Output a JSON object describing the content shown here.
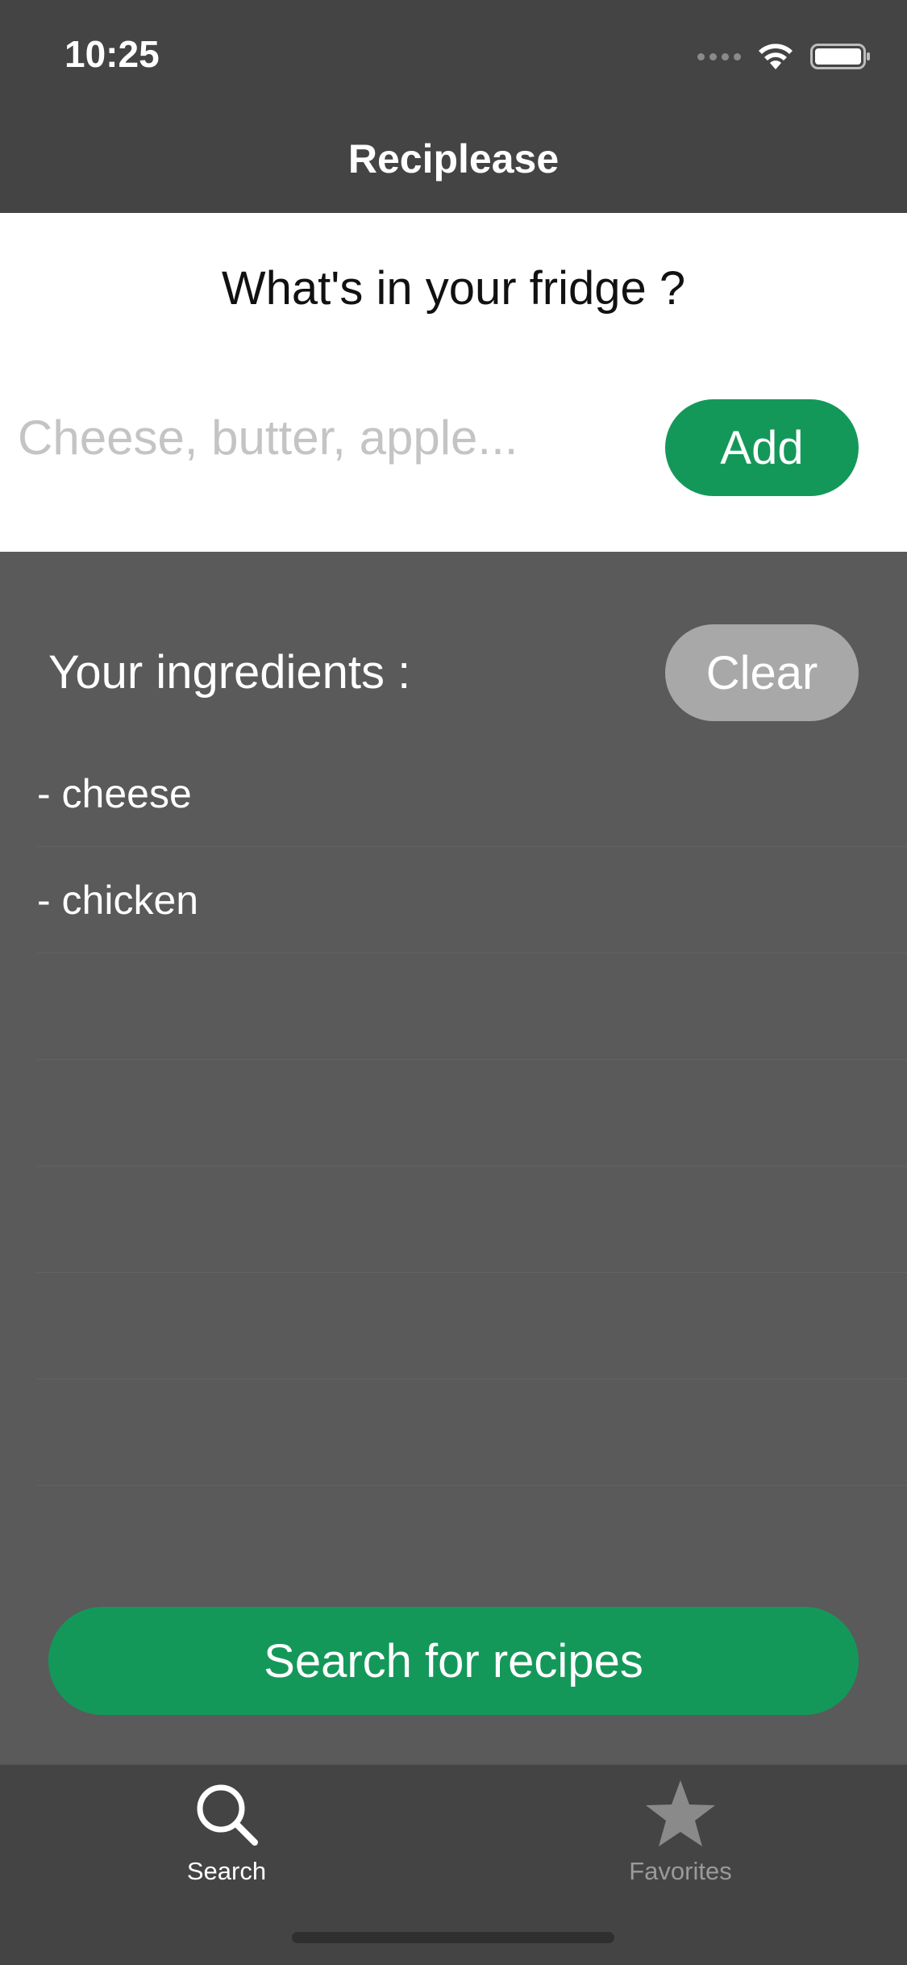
{
  "status_bar": {
    "time": "10:25",
    "icons": [
      "cellular-signal-icon",
      "wifi-icon",
      "battery-icon"
    ]
  },
  "nav": {
    "title": "Reciplease"
  },
  "fridge": {
    "question": "What's in your fridge ?",
    "input_value": "",
    "input_placeholder": "Cheese, butter, apple...",
    "add_label": "Add"
  },
  "ingredients": {
    "header": "Your ingredients :",
    "clear_label": "Clear",
    "items": [
      "- cheese",
      "- chicken",
      "",
      "",
      "",
      "",
      ""
    ]
  },
  "search_label": "Search for recipes",
  "tabbar": {
    "tabs": [
      {
        "label": "Search",
        "icon": "search-icon",
        "selected": true
      },
      {
        "label": "Favorites",
        "icon": "star-icon",
        "selected": false
      }
    ]
  },
  "colors": {
    "accent_green": "#14985a",
    "bar_background": "#444444",
    "content_background": "#5a5a5a",
    "clear_button": "#a8a8a8"
  }
}
